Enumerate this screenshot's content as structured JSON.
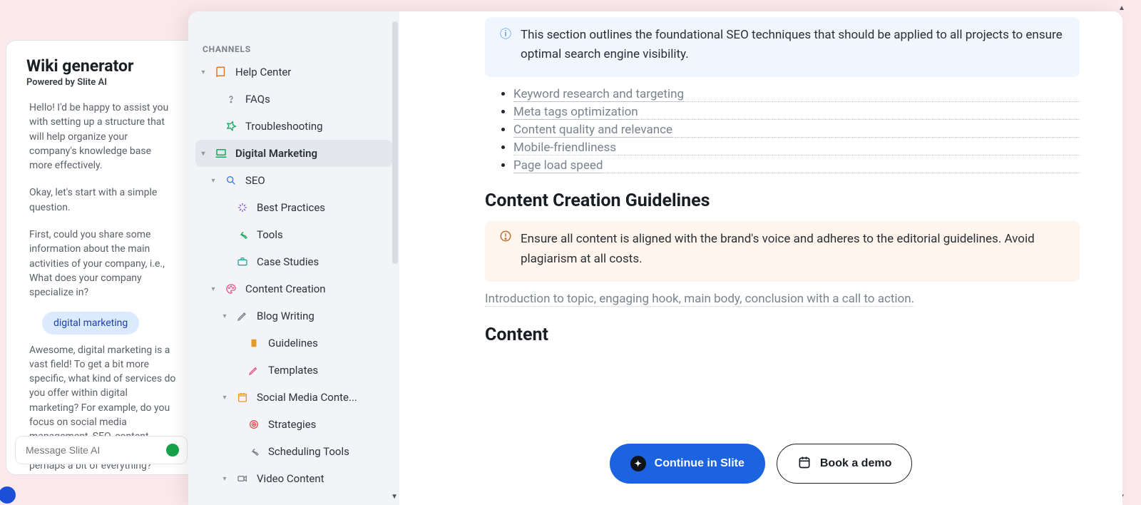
{
  "chat": {
    "title": "Wiki generator",
    "subtitle": "Powered by Slite AI",
    "messages": [
      "Hello! I'd be happy to assist you with setting up a structure that will help organize your company's knowledge base more effectively.",
      "Okay, let's start with a simple question.",
      "First, could you share some information about the main activities of your company, i.e., What does your company specialize in?",
      "Awesome, digital marketing is a vast field! To get a bit more specific, what kind of services do you offer within digital marketing? For example, do you focus on social media management, SEO, content creation, email marketing, or perhaps a bit of everything?"
    ],
    "user_reply": "digital marketing",
    "input_placeholder": "Message Slite AI"
  },
  "sidebar": {
    "heading": "CHANNELS",
    "items": [
      {
        "label": "Help Center"
      },
      {
        "label": "FAQs"
      },
      {
        "label": "Troubleshooting"
      },
      {
        "label": "Digital Marketing"
      },
      {
        "label": "SEO"
      },
      {
        "label": "Best Practices"
      },
      {
        "label": "Tools"
      },
      {
        "label": "Case Studies"
      },
      {
        "label": "Content Creation"
      },
      {
        "label": "Blog Writing"
      },
      {
        "label": "Guidelines"
      },
      {
        "label": "Templates"
      },
      {
        "label": "Social Media Conte..."
      },
      {
        "label": "Strategies"
      },
      {
        "label": "Scheduling Tools"
      },
      {
        "label": "Video Content"
      }
    ]
  },
  "doc": {
    "info_callout": "This section outlines the foundational SEO techniques that should be applied to all projects to ensure optimal search engine visibility.",
    "seo_list": [
      "Keyword research and targeting",
      "Meta tags optimization",
      "Content quality and relevance",
      "Mobile-friendliness",
      "Page load speed"
    ],
    "heading1": "Content Creation Guidelines",
    "warn_callout": "Ensure all content is aligned with the brand's voice and adheres to the editorial guidelines. Avoid plagiarism at all costs.",
    "intro_line": "Introduction to topic, engaging hook, main body, conclusion with a call to action.",
    "heading2": "Content"
  },
  "cta": {
    "primary": "Continue in Slite",
    "secondary": "Book a demo"
  }
}
